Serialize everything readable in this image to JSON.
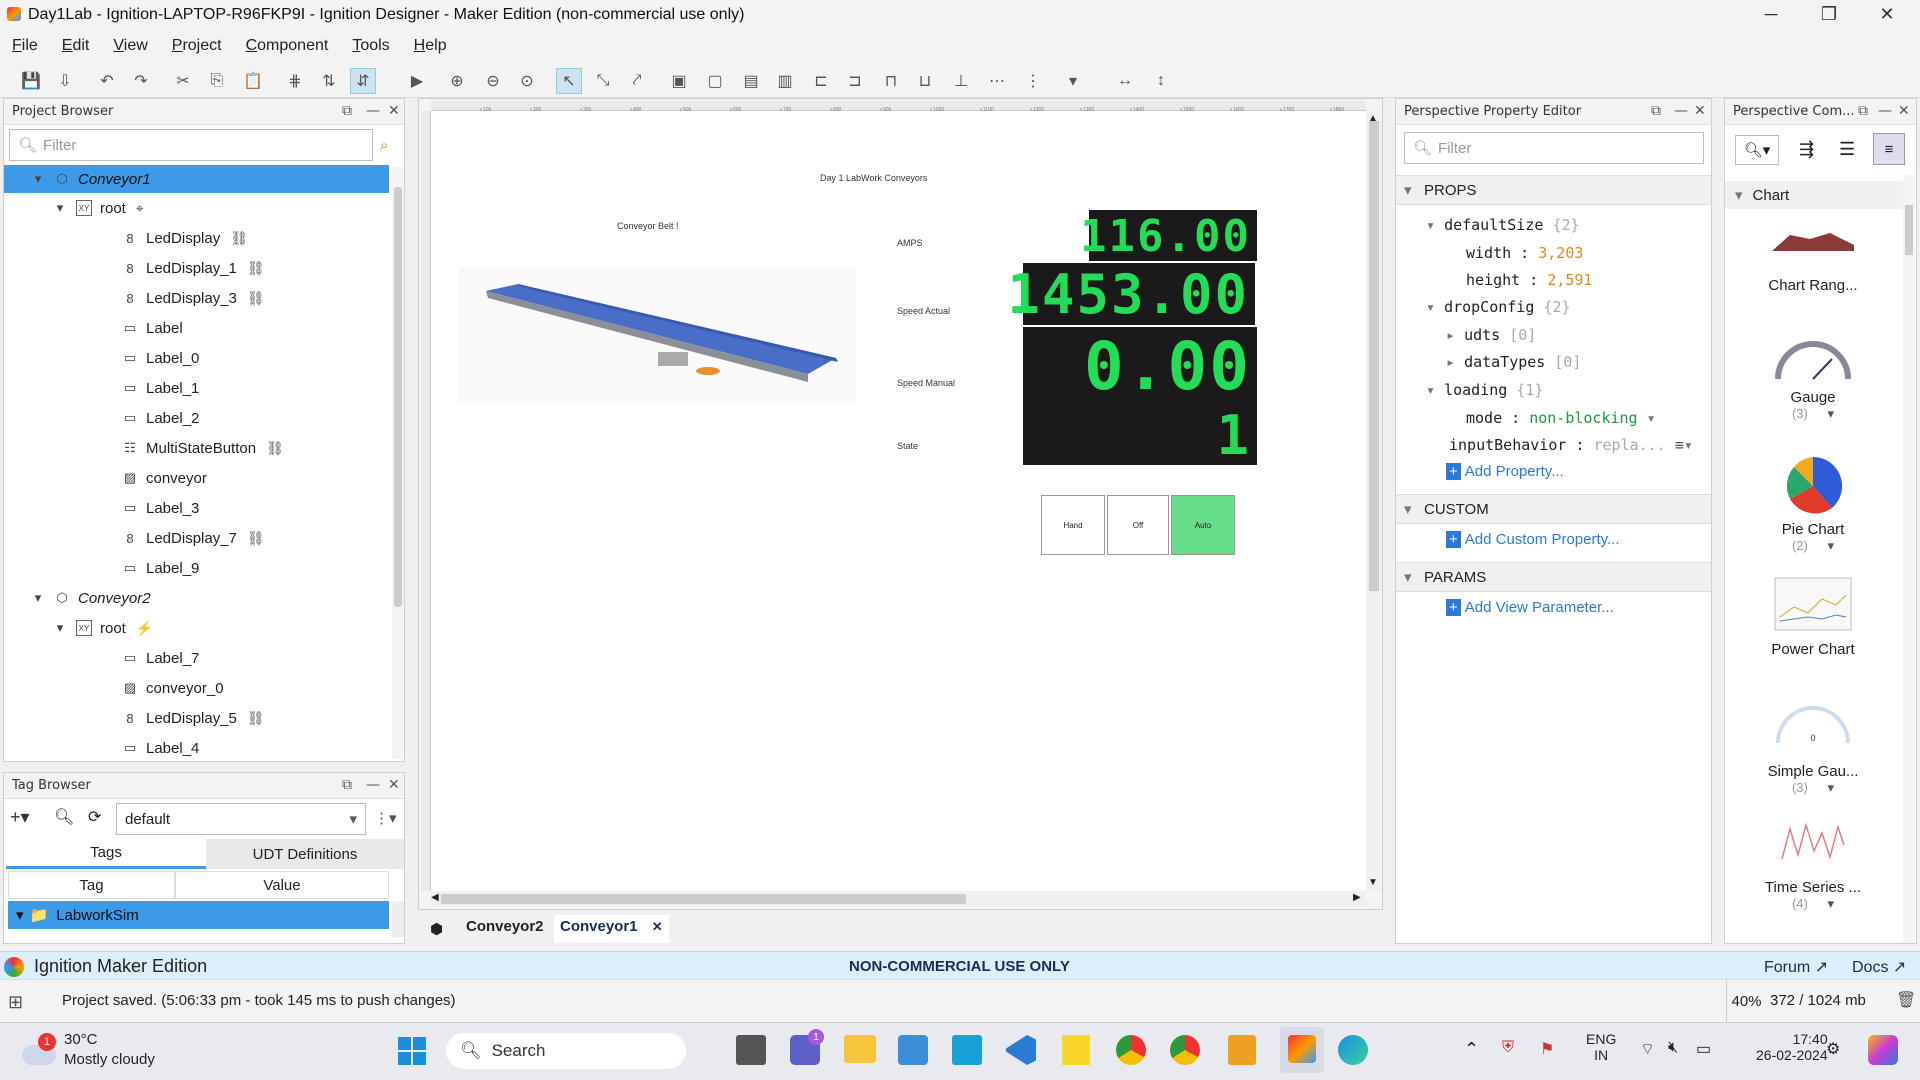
{
  "window": {
    "title": "Day1Lab - Ignition-LAPTOP-R96FKP9I - Ignition Designer - Maker Edition (non-commercial use only)"
  },
  "menu": [
    "File",
    "Edit",
    "View",
    "Project",
    "Component",
    "Tools",
    "Help"
  ],
  "project_browser": {
    "title": "Project Browser",
    "filter_placeholder": "Filter",
    "items": [
      {
        "label": "Conveyor1",
        "type": "view",
        "selected": true
      },
      {
        "label": "root",
        "type": "root"
      },
      {
        "label": "LedDisplay",
        "type": "led",
        "linked": true
      },
      {
        "label": "LedDisplay_1",
        "type": "led",
        "linked": true
      },
      {
        "label": "LedDisplay_3",
        "type": "led",
        "linked": true
      },
      {
        "label": "Label",
        "type": "label"
      },
      {
        "label": "Label_0",
        "type": "label"
      },
      {
        "label": "Label_1",
        "type": "label"
      },
      {
        "label": "Label_2",
        "type": "label"
      },
      {
        "label": "MultiStateButton",
        "type": "msb",
        "linked": true
      },
      {
        "label": "conveyor",
        "type": "image"
      },
      {
        "label": "Label_3",
        "type": "label"
      },
      {
        "label": "LedDisplay_7",
        "type": "led",
        "linked": true
      },
      {
        "label": "Label_9",
        "type": "label"
      },
      {
        "label": "Conveyor2",
        "type": "view"
      },
      {
        "label": "root",
        "type": "root"
      },
      {
        "label": "Label_7",
        "type": "label"
      },
      {
        "label": "conveyor_0",
        "type": "image"
      },
      {
        "label": "LedDisplay_5",
        "type": "led",
        "linked": true
      },
      {
        "label": "Label_4",
        "type": "label"
      }
    ]
  },
  "tag_browser": {
    "title": "Tag Browser",
    "provider": "default",
    "tabs": [
      "Tags",
      "UDT Definitions"
    ],
    "columns": [
      "Tag",
      "Value"
    ],
    "rows": [
      {
        "tag": "LabworkSim",
        "value": ""
      }
    ]
  },
  "canvas": {
    "heading": "Day 1 LabWork  Conveyors",
    "conveyor_label": "Conveyor Belt !",
    "labels": [
      "AMPS",
      "Speed Actual",
      "Speed Manual",
      "State"
    ],
    "led_values": [
      "116.00",
      "1453.00",
      "0.00",
      "1"
    ],
    "buttons": [
      {
        "label": "Hand",
        "active": false
      },
      {
        "label": "Off",
        "active": false
      },
      {
        "label": "Auto",
        "active": true
      }
    ],
    "ruler_ticks": [
      "100",
      "200",
      "300",
      "400",
      "500",
      "600",
      "700",
      "800",
      "900",
      "1000",
      "1100",
      "1200",
      "1300",
      "1400",
      "1500",
      "1600",
      "1700",
      "1800"
    ]
  },
  "doc_tabs": [
    {
      "label": "Conveyor2",
      "active": false
    },
    {
      "label": "Conveyor1",
      "active": true,
      "close": "✕"
    }
  ],
  "property_editor": {
    "title": "Perspective Property Editor",
    "filter_placeholder": "Filter",
    "sections": [
      "PROPS",
      "CUSTOM",
      "PARAMS"
    ],
    "props": {
      "defaultSize": "defaultSize",
      "defaultSize_count": "{2}",
      "width_key": "width",
      "width_val": "3,203",
      "height_key": "height",
      "height_val": "2,591",
      "dropConfig": "dropConfig",
      "dropConfig_count": "{2}",
      "udts": "udts",
      "udts_count": "[0]",
      "dataTypes": "dataTypes",
      "dataTypes_count": "[0]",
      "loading": "loading",
      "loading_count": "{1}",
      "mode_key": "mode",
      "mode_val": "non-blocking",
      "inputBehavior_key": "inputBehavior",
      "inputBehavior_val": "repla...",
      "add_property": "Add Property...",
      "add_custom": "Add Custom Property...",
      "add_param": "Add View Parameter..."
    }
  },
  "component_palette": {
    "title": "Perspective Com...",
    "category": "Chart",
    "items": [
      {
        "label": "Chart Rang...",
        "count": ""
      },
      {
        "label": "Gauge",
        "count": "(3)"
      },
      {
        "label": "Pie Chart",
        "count": "(2)"
      },
      {
        "label": "Power Chart",
        "count": ""
      },
      {
        "label": "Simple Gau...",
        "count": "(3)"
      },
      {
        "label": "Time Series ...",
        "count": "(4)"
      }
    ],
    "gauge_value": "0"
  },
  "edition_bar": {
    "product": "Ignition Maker Edition",
    "notice": "NON-COMMERCIAL USE ONLY",
    "forum": "Forum",
    "docs": "Docs"
  },
  "status": {
    "message": "Project saved. (5:06:33 pm - took 145 ms to push changes)",
    "zoom": "40%",
    "memory": "372 / 1024 mb"
  },
  "taskbar": {
    "temp": "30°C",
    "weather": "Mostly cloudy",
    "weather_badge": "1",
    "search": "Search",
    "lang1": "ENG",
    "lang2": "IN",
    "time": "17:40",
    "date": "26-02-2024",
    "teams_badge": "1"
  },
  "colors": {
    "selection": "#3d9ae8",
    "led_bg": "#1a1a1a",
    "led_fg": "#22dd55",
    "auto_btn": "#66dd88",
    "edition_bg": "#dceefa"
  }
}
